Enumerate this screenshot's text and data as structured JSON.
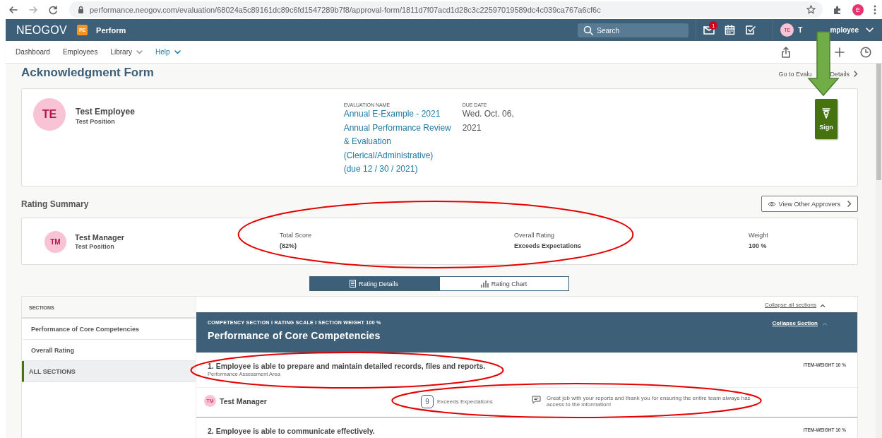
{
  "browser": {
    "url": "performance.neogov.com/evaluation/68024a5c89161dc89c6fd1547289b7f8/approval-form/1811d7f07acd1d28c3c22597019589dc4c039ca767a6cf6c",
    "profile": "E"
  },
  "header": {
    "logo": "NEOGOV",
    "app_badge": "PE",
    "app_name": "Perform",
    "search": {
      "placeholder": "Search"
    },
    "mail_count": "1",
    "user": {
      "initials": "TE",
      "name_parts": [
        "T",
        "mployee"
      ]
    }
  },
  "nav": [
    {
      "label": "Dashboard",
      "selected": false,
      "dropdown": false
    },
    {
      "label": "Employees",
      "selected": false,
      "dropdown": false
    },
    {
      "label": "Library",
      "selected": false,
      "dropdown": true
    },
    {
      "label": "Help",
      "selected": true,
      "dropdown": true
    }
  ],
  "page": {
    "title": "Acknowledgment Form",
    "back_link_parts": [
      "Go to Evalu",
      "Details"
    ]
  },
  "employee": {
    "initials": "TE",
    "name": "Test Employee",
    "position": "Test Position",
    "evaluation_label": "EVALUATION NAME",
    "evaluation_lines": [
      "Annual E-Example - 2021",
      "Annual Performance Review",
      "& Evaluation",
      "(Clerical/Administrative)",
      "(due 12 / 30 / 2021)"
    ],
    "due_label": "DUE DATE",
    "due_lines": [
      "Wed. Oct. 06,",
      "2021"
    ],
    "sign": "Sign"
  },
  "summary": {
    "title": "Rating Summary",
    "approvers_button": "View Other Approvers",
    "initials": "TM",
    "name": "Test Manager",
    "position": "Test Position",
    "stats": [
      {
        "label": "Total Score",
        "value": "(82%)"
      },
      {
        "label": "Overall Rating",
        "value": "Exceeds Expectations"
      },
      {
        "label": "Weight",
        "value": "100 %"
      }
    ]
  },
  "view_tabs": [
    {
      "label": "Rating Details",
      "selected": true
    },
    {
      "label": "Rating Chart",
      "selected": false
    }
  ],
  "sections": {
    "header": "SECTIONS",
    "items": [
      {
        "label": "Performance of Core Competencies",
        "selected": false
      },
      {
        "label": "Overall Rating",
        "selected": false
      },
      {
        "label": "ALL SECTIONS",
        "selected": true
      }
    ]
  },
  "details": {
    "collapse_all": "Collapse all sections",
    "section_meta": "COMPETENCY SECTION I RATING SCALE I SECTION WEIGHT 100 %",
    "section_title": "Performance of Core Competencies",
    "collapse_section": "Collapse Section",
    "items": [
      {
        "title": "1. Employee is able to prepare and maintain detailed records, files and reports.",
        "subtitle": "Performance Assessment Area",
        "weight": "ITEM-WEIGHT 10 %",
        "rating": {
          "initials": "TM",
          "rater": "Test Manager",
          "score": "9",
          "label": "Exceeds Expectations",
          "comment": "Great job with your reports and thank you for ensuring the entire team always has access to the information!"
        }
      },
      {
        "title": "2. Employee is able to communicate effectively.",
        "weight": "ITEM-WEIGHT 10 %"
      }
    ]
  },
  "annotations": [
    {
      "kind": "ellipse"
    },
    {
      "kind": "ellipse"
    },
    {
      "kind": "ellipse"
    },
    {
      "kind": "arrow"
    }
  ]
}
